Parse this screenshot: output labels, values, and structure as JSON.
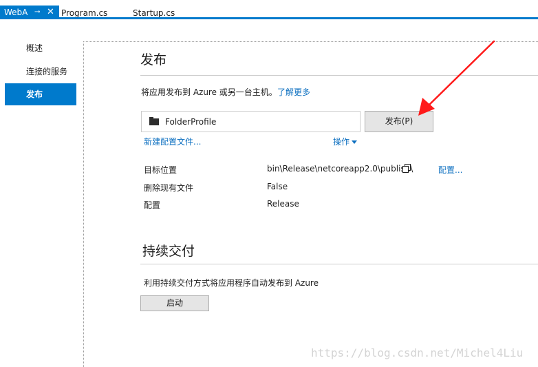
{
  "tabs": [
    {
      "label": "WebA"
    },
    {
      "label": "Program.cs"
    },
    {
      "label": "Startup.cs"
    }
  ],
  "sidebar": {
    "items": [
      {
        "label": "概述"
      },
      {
        "label": "连接的服务"
      },
      {
        "label": "发布"
      }
    ]
  },
  "publish": {
    "heading": "发布",
    "description": "将应用发布到 Azure 或另一台主机。",
    "learn_more": "了解更多",
    "profile_name": "FolderProfile",
    "publish_button": "发布(P)",
    "new_profile_link": "新建配置文件...",
    "actions_link": "操作",
    "settings": [
      {
        "label": "目标位置",
        "value": "bin\\Release\\netcoreapp2.0\\publish\\"
      },
      {
        "label": "删除现有文件",
        "value": "False"
      },
      {
        "label": "配置",
        "value": "Release"
      }
    ],
    "configure_link": "配置..."
  },
  "cd": {
    "heading": "持续交付",
    "description": "利用持续交付方式将应用程序自动发布到 Azure",
    "start_button": "启动"
  },
  "watermark": "https://blog.csdn.net/Michel4Liu",
  "colors": {
    "accent": "#007acc",
    "link": "#0e70c0",
    "arrow": "#ff0000"
  }
}
